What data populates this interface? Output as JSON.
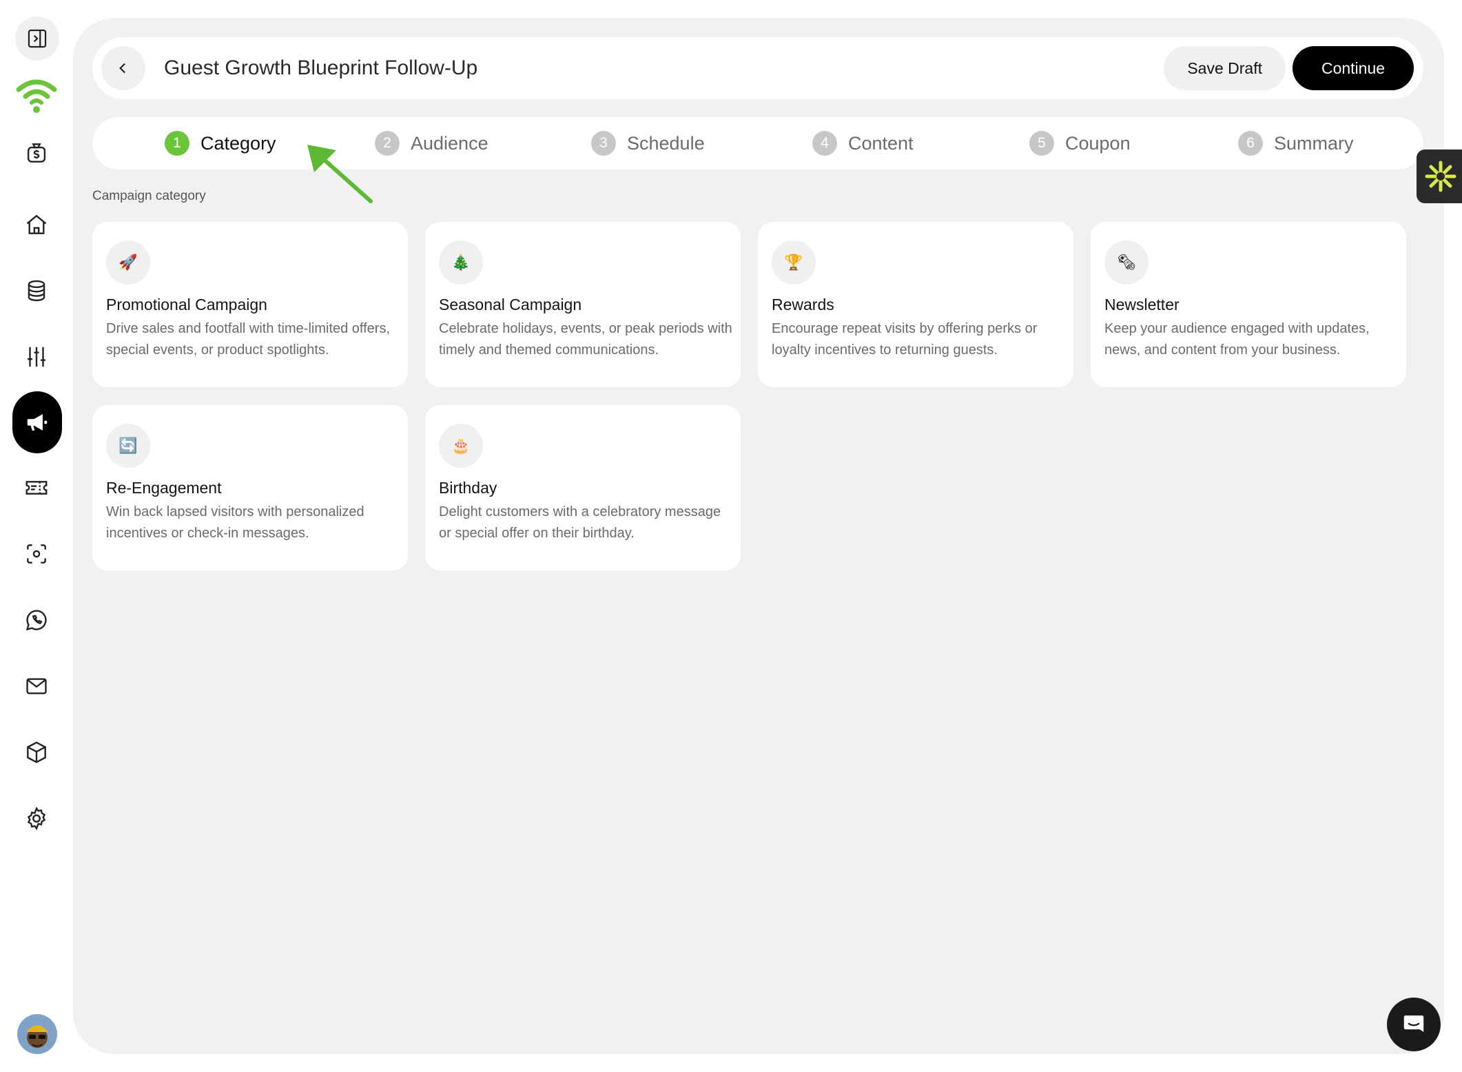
{
  "app": {
    "page_title": "Guest Growth Blueprint Follow-Up",
    "save_draft_label": "Save Draft",
    "continue_label": "Continue",
    "accent_color": "#6cc43a"
  },
  "sidebar": {
    "items": [
      {
        "icon": "panel-toggle-icon"
      },
      {
        "icon": "wifi-logo-icon"
      },
      {
        "icon": "money-bag-icon"
      },
      {
        "icon": "home-icon"
      },
      {
        "icon": "database-icon"
      },
      {
        "icon": "sliders-icon"
      },
      {
        "icon": "megaphone-icon",
        "active": true
      },
      {
        "icon": "ticket-icon"
      },
      {
        "icon": "scan-icon"
      },
      {
        "icon": "whatsapp-icon"
      },
      {
        "icon": "mail-icon"
      },
      {
        "icon": "box-icon"
      },
      {
        "icon": "settings-icon"
      }
    ]
  },
  "steps": [
    {
      "num": "1",
      "label": "Category",
      "active": true
    },
    {
      "num": "2",
      "label": "Audience"
    },
    {
      "num": "3",
      "label": "Schedule"
    },
    {
      "num": "4",
      "label": "Content"
    },
    {
      "num": "5",
      "label": "Coupon"
    },
    {
      "num": "6",
      "label": "Summary"
    }
  ],
  "section_label": "Campaign category",
  "cards": [
    {
      "emoji": "🚀",
      "title": "Promotional Campaign",
      "desc": "Drive sales and footfall with time-limited offers, special events, or product spotlights."
    },
    {
      "emoji": "🎄",
      "title": "Seasonal Campaign",
      "desc": "Celebrate holidays, events, or peak periods with timely and themed communications."
    },
    {
      "emoji": "🏆",
      "title": "Rewards",
      "desc": "Encourage repeat visits by offering perks or loyalty incentives to returning guests."
    },
    {
      "emoji": "🗞",
      "title": "Newsletter",
      "desc": "Keep your audience engaged with updates, news, and content from your business."
    },
    {
      "emoji": "🔄",
      "title": "Re-Engagement",
      "desc": "Win back lapsed visitors with personalized incentives or check-in messages."
    },
    {
      "emoji": "🎂",
      "title": "Birthday",
      "desc": "Delight customers with a celebratory message or special offer on their birthday."
    }
  ]
}
